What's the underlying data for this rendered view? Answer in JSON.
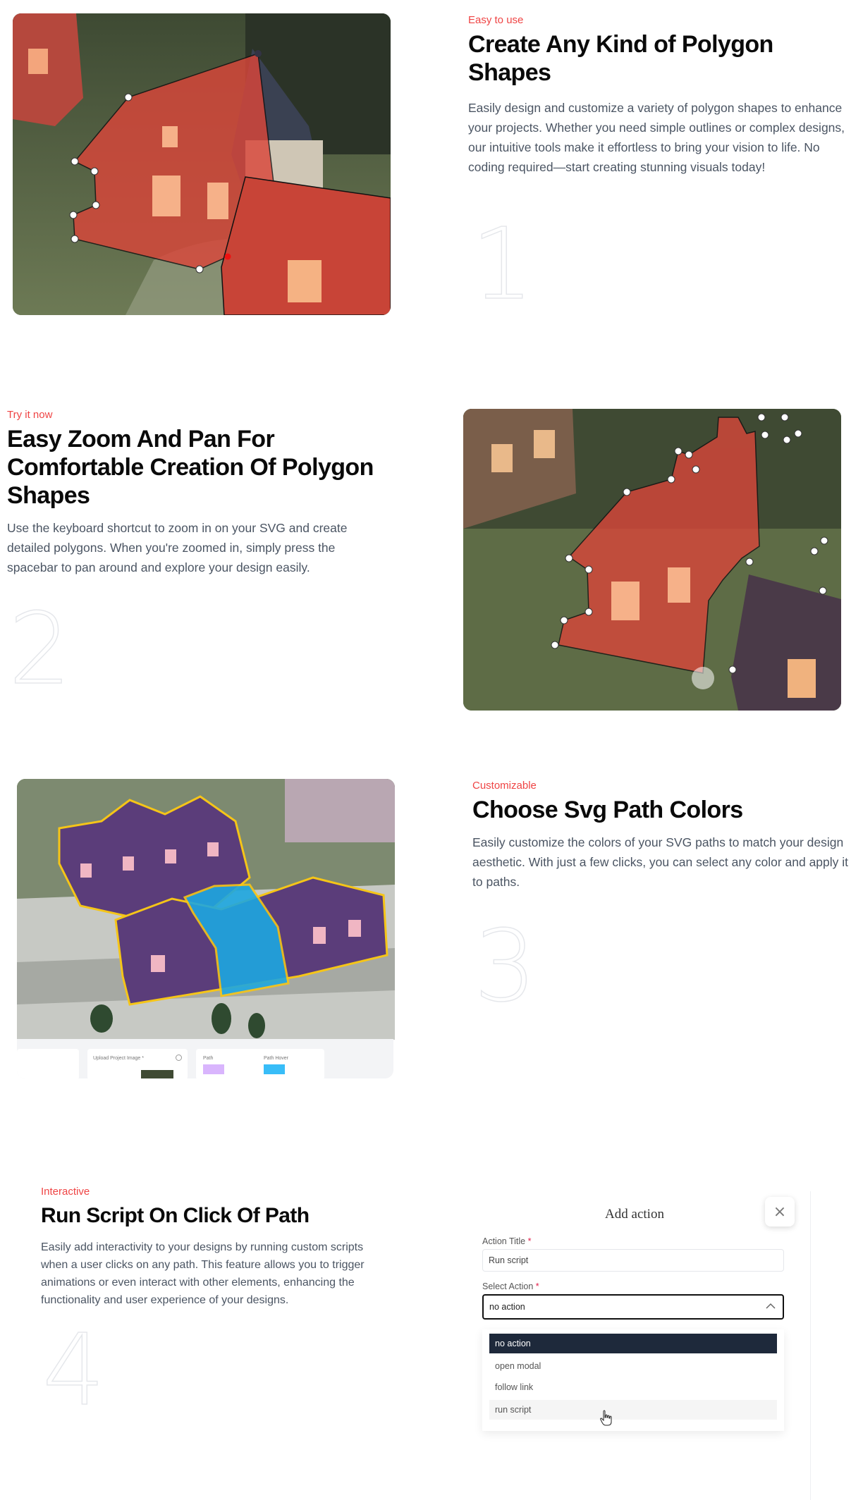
{
  "features": [
    {
      "eyebrow": "Easy to use",
      "title": "Create Any Kind of Polygon Shapes",
      "description": "Easily design and customize a variety of polygon shapes to enhance your projects. Whether you need simple outlines or complex designs, our intuitive tools make it effortless to bring your vision to life. No coding required—start creating stunning visuals today!",
      "number": "1"
    },
    {
      "eyebrow": "Try it now",
      "title": "Easy Zoom And Pan For Comfortable Creation Of Polygon Shapes",
      "description": "Use the keyboard shortcut to zoom in on your SVG and create detailed polygons. When you're zoomed in, simply press the spacebar to pan around and explore your design easily.",
      "number": "2"
    },
    {
      "eyebrow": "Customizable",
      "title": "Choose Svg Path Colors",
      "description": "Easily customize the colors of your SVG paths to match your design aesthetic. With just a few clicks, you can select any color and apply it to paths.",
      "number": "3"
    },
    {
      "eyebrow": "Interactive",
      "title": "Run Script On Click Of Path",
      "description": "Easily add interactivity to your designs by running custom scripts when a user clicks on any path. This feature allows you to trigger animations or even interact with other elements, enhancing the functionality and user experience of your designs.",
      "number": "4"
    }
  ],
  "toolbar": {
    "upload_label": "Upload Project Image *",
    "path_label": "Path",
    "path_hover_label": "Path Hover",
    "path_color": "#c084fc",
    "path_hover_color": "#38bdf8"
  },
  "add_action": {
    "title": "Add action",
    "close_glyph": "×",
    "action_title_label": "Action Title",
    "action_title_value": "Run script",
    "select_action_label": "Select Action",
    "required_mark": "*",
    "selected_value": "no action",
    "options": [
      "no action",
      "open modal",
      "follow link",
      "run script"
    ]
  },
  "colors": {
    "eyebrow": "#ef4444",
    "polygon_fill": "#d9463a",
    "selected_fill": "#1ea7e0",
    "house_purple": "#5b3d7a",
    "outline_yellow": "#f5c518"
  }
}
